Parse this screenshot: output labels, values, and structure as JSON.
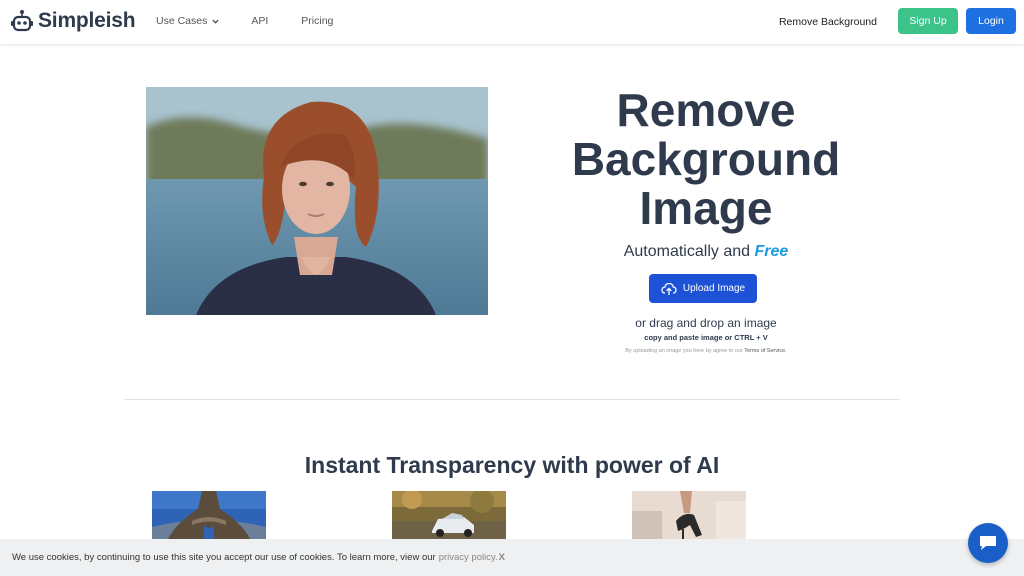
{
  "header": {
    "brand": "Simpleish",
    "nav": {
      "use_cases": "Use Cases",
      "api": "API",
      "pricing": "Pricing"
    },
    "remove_background": "Remove Background",
    "signup": "Sign Up",
    "login": "Login"
  },
  "hero": {
    "title_line1": "Remove",
    "title_line2": "Background",
    "title_line3": "Image",
    "subtitle_prefix": "Automatically and",
    "subtitle_emph": "Free",
    "upload_button": "Upload Image",
    "drag_text": "or drag and drop an image",
    "paste_text": "copy and paste image or CTRL + V",
    "terms_prefix": "By uploading an image you here by agree to our",
    "terms_link": "Terms of Service."
  },
  "section": {
    "title": "Instant Transparency with power of AI"
  },
  "cookie": {
    "text": "We use cookies, by continuing to use this site you accept our use of cookies. To learn more, view our",
    "policy_link": "privacy policy.",
    "close": "X"
  },
  "colors": {
    "signup": "#3cc38a",
    "login": "#1e6fe0",
    "upload": "#1e52d6",
    "free_accent": "#1a9be0",
    "chat": "#1a5fc7"
  }
}
